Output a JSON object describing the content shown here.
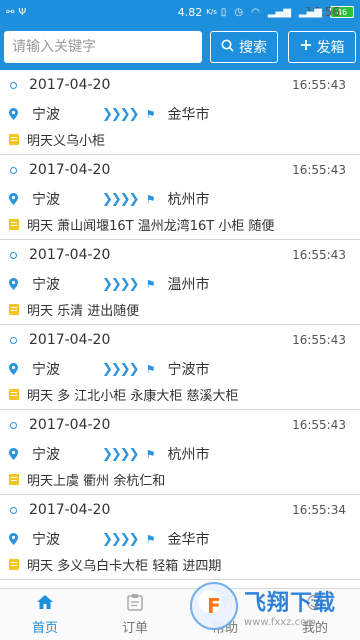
{
  "status_bar": {
    "time": "16:56",
    "speed": "4.82",
    "speed_unit": "K/s",
    "battery": "46"
  },
  "search": {
    "placeholder": "请输入关键字",
    "search_label": "搜索",
    "post_label": "发箱"
  },
  "orders": [
    {
      "date": "2017-04-20",
      "time": "16:55:43",
      "from": "宁波",
      "to": "金华市",
      "note": "明天义乌小柜"
    },
    {
      "date": "2017-04-20",
      "time": "16:55:43",
      "from": "宁波",
      "to": "杭州市",
      "note": "明天  萧山闻堰16T  温州龙湾16T 小柜 随便"
    },
    {
      "date": "2017-04-20",
      "time": "16:55:43",
      "from": "宁波",
      "to": "温州市",
      "note": "明天 乐清     进出随便"
    },
    {
      "date": "2017-04-20",
      "time": "16:55:43",
      "from": "宁波",
      "to": "宁波市",
      "note": "明天 多 江北小柜 永康大柜 慈溪大柜"
    },
    {
      "date": "2017-04-20",
      "time": "16:55:43",
      "from": "宁波",
      "to": "杭州市",
      "note": "明天上虞 衢州 余杭仁和"
    },
    {
      "date": "2017-04-20",
      "time": "16:55:34",
      "from": "宁波",
      "to": "金华市",
      "note": "明天  多义乌白卡大柜  轻箱 进四期"
    }
  ],
  "tabs": [
    {
      "label": "首页",
      "icon": "home-icon",
      "active": true
    },
    {
      "label": "订单",
      "icon": "clipboard-icon",
      "active": false
    },
    {
      "label": "帮助",
      "icon": "help-icon",
      "active": false
    },
    {
      "label": "我的",
      "icon": "user-icon",
      "active": false
    }
  ],
  "watermark": {
    "text": "飞翔下载",
    "url": "www.fxxz.com"
  },
  "colors": {
    "primary": "#1e8fdd",
    "accent_blue": "#2a94de",
    "note_yellow": "#f5c623"
  }
}
